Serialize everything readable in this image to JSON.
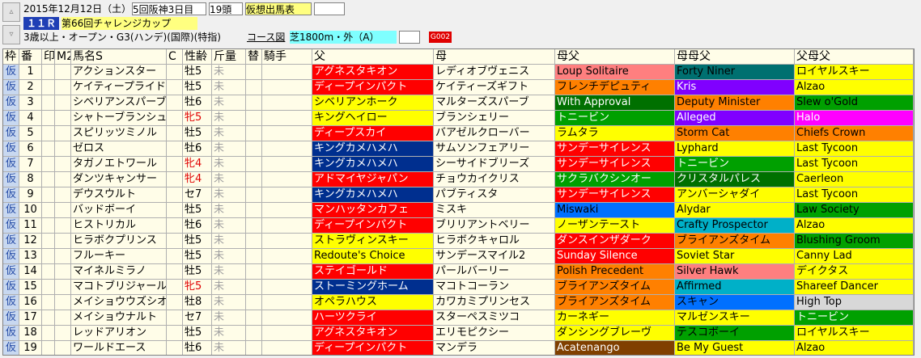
{
  "header": {
    "nav_up_icon": "up-arrow-icon",
    "nav_down_icon": "down-arrow-icon",
    "date": "2015年12月12日（土）",
    "meeting": "5回阪神3日目",
    "heads": "19頭",
    "card_type": "仮想出馬表",
    "race_no": "１１Ｒ",
    "race_name": "第66回チャレンジカップ",
    "conditions": "3歳以上・オープン・G3(ハンデ)(国際)(特指)",
    "course_label": "コース図",
    "course": "芝1800m・外（A）",
    "code": "G002"
  },
  "columns": [
    "枠",
    "番",
    "印",
    "M2",
    "馬名S",
    "C",
    "性齢",
    "斤量",
    "替",
    "騎手",
    "父",
    "母",
    "母父",
    "母母父",
    "父母父"
  ],
  "rows": [
    {
      "waku": "仮",
      "ban": "1",
      "name": "アクションスター",
      "sexage": "牡5",
      "red": false,
      "kin": "未",
      "sire": "アグネスタキオン",
      "sc": "#ff0000",
      "stc": "#ffffff",
      "dam": "レディオブヴェニス",
      "bms": "Loup Solitaire",
      "bc": "#ff7f7f",
      "btc": "#000000",
      "bbms": "Forty Niner",
      "bbc": "#007070",
      "bbtc": "#000000",
      "ssire": "ロイヤルスキー",
      "ssc": "#ffff00",
      "sstc": "#000000"
    },
    {
      "waku": "仮",
      "ban": "2",
      "name": "ケイティープライド",
      "sexage": "牡5",
      "red": false,
      "kin": "未",
      "sire": "ディープインパクト",
      "sc": "#ff0000",
      "stc": "#ffffff",
      "dam": "ケイティーズギフト",
      "bms": "フレンチデピュティ",
      "bc": "#ff8000",
      "btc": "#000000",
      "bbms": "Kris",
      "bbc": "#8000ff",
      "bbtc": "#ffffff",
      "ssire": "Alzao",
      "ssc": "#ffff00",
      "sstc": "#000000"
    },
    {
      "waku": "仮",
      "ban": "3",
      "name": "シベリアンスパーブ",
      "sexage": "牡6",
      "red": false,
      "kin": "未",
      "sire": "シベリアンホーク",
      "sc": "#ffff00",
      "stc": "#000000",
      "dam": "マルターズスパーブ",
      "bms": "With Approval",
      "bc": "#007000",
      "btc": "#ffffff",
      "bbms": "Deputy Minister",
      "bbc": "#ff8000",
      "bbtc": "#000000",
      "ssire": "Slew o'Gold",
      "ssc": "#00a000",
      "sstc": "#000000"
    },
    {
      "waku": "仮",
      "ban": "4",
      "name": "シャトーブランシュ",
      "sexage": "牝5",
      "red": true,
      "kin": "未",
      "sire": "キングヘイロー",
      "sc": "#ffff00",
      "stc": "#000000",
      "dam": "ブランシェリー",
      "bms": "トニービン",
      "bc": "#00a000",
      "btc": "#ffffff",
      "bbms": "Alleged",
      "bbc": "#8000ff",
      "bbtc": "#ffffff",
      "ssire": "Halo",
      "ssc": "#ff00ff",
      "sstc": "#ffffff"
    },
    {
      "waku": "仮",
      "ban": "5",
      "name": "スピリッツミノル",
      "sexage": "牡5",
      "red": false,
      "kin": "未",
      "sire": "ディープスカイ",
      "sc": "#ff0000",
      "stc": "#ffffff",
      "dam": "バアゼルクローバー",
      "bms": "ラムタラ",
      "bc": "#ffff00",
      "btc": "#000000",
      "bbms": "Storm Cat",
      "bbc": "#ff8000",
      "bbtc": "#000000",
      "ssire": "Chiefs Crown",
      "ssc": "#ff8000",
      "sstc": "#000000"
    },
    {
      "waku": "仮",
      "ban": "6",
      "name": "ゼロス",
      "sexage": "牡6",
      "red": false,
      "kin": "未",
      "sire": "キングカメハメハ",
      "sc": "#002f8f",
      "stc": "#ffffff",
      "dam": "サムソンフェアリー",
      "bms": "サンデーサイレンス",
      "bc": "#ff0000",
      "btc": "#ffffff",
      "bbms": "Lyphard",
      "bbc": "#ffff00",
      "bbtc": "#000000",
      "ssire": "Last Tycoon",
      "ssc": "#ffff00",
      "sstc": "#000000"
    },
    {
      "waku": "仮",
      "ban": "7",
      "name": "タガノエトワール",
      "sexage": "牝4",
      "red": true,
      "kin": "未",
      "sire": "キングカメハメハ",
      "sc": "#002f8f",
      "stc": "#ffffff",
      "dam": "シーサイドブリーズ",
      "bms": "サンデーサイレンス",
      "bc": "#ff0000",
      "btc": "#ffffff",
      "bbms": "トニービン",
      "bbc": "#00a000",
      "bbtc": "#ffffff",
      "ssire": "Last Tycoon",
      "ssc": "#ffff00",
      "sstc": "#000000"
    },
    {
      "waku": "仮",
      "ban": "8",
      "name": "ダンツキャンサー",
      "sexage": "牝4",
      "red": true,
      "kin": "未",
      "sire": "アドマイヤジャパン",
      "sc": "#ff0000",
      "stc": "#ffffff",
      "dam": "チョウカイクリス",
      "bms": "サクラバクシンオー",
      "bc": "#00a000",
      "btc": "#ffffff",
      "bbms": "クリスタルパレス",
      "bbc": "#007000",
      "bbtc": "#ffffff",
      "ssire": "Caerleon",
      "ssc": "#ffff00",
      "sstc": "#000000"
    },
    {
      "waku": "仮",
      "ban": "9",
      "name": "デウスウルト",
      "sexage": "セ7",
      "red": false,
      "kin": "未",
      "sire": "キングカメハメハ",
      "sc": "#002f8f",
      "stc": "#ffffff",
      "dam": "パブティスタ",
      "bms": "サンデーサイレンス",
      "bc": "#ff0000",
      "btc": "#ffffff",
      "bbms": "アンバーシャダイ",
      "bbc": "#ffff00",
      "bbtc": "#000000",
      "ssire": "Last Tycoon",
      "ssc": "#ffff00",
      "sstc": "#000000"
    },
    {
      "waku": "仮",
      "ban": "10",
      "name": "バッドボーイ",
      "sexage": "牡5",
      "red": false,
      "kin": "未",
      "sire": "マンハッタンカフェ",
      "sc": "#ff0000",
      "stc": "#ffffff",
      "dam": "ミスキ",
      "bms": "Miswaki",
      "bc": "#0070ff",
      "btc": "#000000",
      "bbms": "Alydar",
      "bbc": "#ffff00",
      "bbtc": "#000000",
      "ssire": "Law Society",
      "ssc": "#00a000",
      "sstc": "#000000"
    },
    {
      "waku": "仮",
      "ban": "11",
      "name": "ヒストリカル",
      "sexage": "牡6",
      "red": false,
      "kin": "未",
      "sire": "ディープインパクト",
      "sc": "#ff0000",
      "stc": "#ffffff",
      "dam": "ブリリアントベリー",
      "bms": "ノーザンテースト",
      "bc": "#ffff00",
      "btc": "#000000",
      "bbms": "Crafty Prospector",
      "bbc": "#00b0c8",
      "bbtc": "#000000",
      "ssire": "Alzao",
      "ssc": "#ffff00",
      "sstc": "#000000"
    },
    {
      "waku": "仮",
      "ban": "12",
      "name": "ヒラボクプリンス",
      "sexage": "牡5",
      "red": false,
      "kin": "未",
      "sire": "ストラヴィンスキー",
      "sc": "#ffff00",
      "stc": "#000000",
      "dam": "ヒラボクキャロル",
      "bms": "ダンスインザダーク",
      "bc": "#ff0000",
      "btc": "#ffffff",
      "bbms": "ブライアンズタイム",
      "bbc": "#ff8000",
      "bbtc": "#000000",
      "ssire": "Blushing Groom",
      "ssc": "#00a000",
      "sstc": "#000000"
    },
    {
      "waku": "仮",
      "ban": "13",
      "name": "フルーキー",
      "sexage": "牡5",
      "red": false,
      "kin": "未",
      "sire": "Redoute's Choice",
      "sc": "#ffff00",
      "stc": "#000000",
      "dam": "サンデースマイル2",
      "bms": "Sunday Silence",
      "bc": "#ff0000",
      "btc": "#ffffff",
      "bbms": "Soviet Star",
      "bbc": "#ffff00",
      "bbtc": "#000000",
      "ssire": "Canny Lad",
      "ssc": "#ffff00",
      "sstc": "#000000"
    },
    {
      "waku": "仮",
      "ban": "14",
      "name": "マイネルミラノ",
      "sexage": "牡5",
      "red": false,
      "kin": "未",
      "sire": "ステイゴールド",
      "sc": "#ff0000",
      "stc": "#ffffff",
      "dam": "パールバーリー",
      "bms": "Polish Precedent",
      "bc": "#ff8000",
      "btc": "#000000",
      "bbms": "Silver Hawk",
      "bbc": "#ff7f7f",
      "bbtc": "#000000",
      "ssire": "デイクタス",
      "ssc": "#ffff00",
      "sstc": "#000000"
    },
    {
      "waku": "仮",
      "ban": "15",
      "name": "マコトブリジャール",
      "sexage": "牝5",
      "red": true,
      "kin": "未",
      "sire": "ストーミングホーム",
      "sc": "#002f8f",
      "stc": "#ffffff",
      "dam": "マコトコーラン",
      "bms": "ブライアンズタイム",
      "bc": "#ff8000",
      "btc": "#000000",
      "bbms": "Affirmed",
      "bbc": "#00b0c8",
      "bbtc": "#000000",
      "ssire": "Shareef Dancer",
      "ssc": "#ffff00",
      "sstc": "#000000"
    },
    {
      "waku": "仮",
      "ban": "16",
      "name": "メイショウウズシオ",
      "sexage": "牡8",
      "red": false,
      "kin": "未",
      "sire": "オペラハウス",
      "sc": "#ffff00",
      "stc": "#000000",
      "dam": "カワカミプリンセス",
      "bms": "ブライアンズタイム",
      "bc": "#ff8000",
      "btc": "#000000",
      "bbms": "スキャン",
      "bbc": "#0070ff",
      "bbtc": "#000000",
      "ssire": "High Top",
      "ssc": "#d8d8d8",
      "sstc": "#000000"
    },
    {
      "waku": "仮",
      "ban": "17",
      "name": "メイショウナルト",
      "sexage": "セ7",
      "red": false,
      "kin": "未",
      "sire": "ハーツクライ",
      "sc": "#ff0000",
      "stc": "#ffffff",
      "dam": "スターペスミツコ",
      "bms": "カーネギー",
      "bc": "#ffff00",
      "btc": "#000000",
      "bbms": "マルゼンスキー",
      "bbc": "#ffff00",
      "bbtc": "#000000",
      "ssire": "トニービン",
      "ssc": "#00a000",
      "sstc": "#ffffff"
    },
    {
      "waku": "仮",
      "ban": "18",
      "name": "レッドアリオン",
      "sexage": "牡5",
      "red": false,
      "kin": "未",
      "sire": "アグネスタキオン",
      "sc": "#ff0000",
      "stc": "#ffffff",
      "dam": "エリモピクシー",
      "bms": "ダンシングブレーヴ",
      "bc": "#ffff00",
      "btc": "#000000",
      "bbms": "テスコボーイ",
      "bbc": "#00a000",
      "bbtc": "#000000",
      "ssire": "ロイヤルスキー",
      "ssc": "#ffff00",
      "sstc": "#000000"
    },
    {
      "waku": "仮",
      "ban": "19",
      "name": "ワールドエース",
      "sexage": "牡6",
      "red": false,
      "kin": "未",
      "sire": "ディープインパクト",
      "sc": "#ff0000",
      "stc": "#ffffff",
      "dam": "マンデラ",
      "bms": "Acatenango",
      "bc": "#804000",
      "btc": "#ffffff",
      "bbms": "Be My Guest",
      "bbc": "#ffff00",
      "bbtc": "#000000",
      "ssire": "Alzao",
      "ssc": "#ffff00",
      "sstc": "#000000"
    }
  ]
}
